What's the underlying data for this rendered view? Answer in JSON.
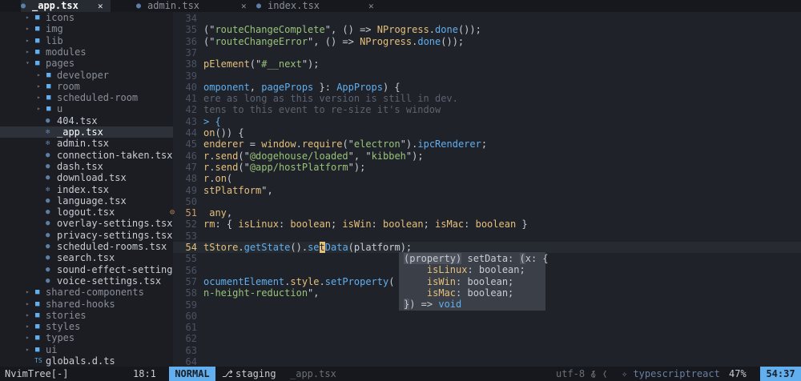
{
  "tabs": [
    {
      "label": "_app.tsx",
      "icon": "●",
      "close": "✕"
    },
    {
      "label": "admin.tsx",
      "icon": "●",
      "close": "✕"
    },
    {
      "label": "index.tsx",
      "icon": "●",
      "close": "✕"
    }
  ],
  "tree": {
    "items": [
      {
        "label": "icons",
        "type": "folder",
        "depth": 0,
        "arrow": "▸"
      },
      {
        "label": "img",
        "type": "folder",
        "depth": 0,
        "arrow": "▸"
      },
      {
        "label": "lib",
        "type": "folder",
        "depth": 0,
        "arrow": "▸"
      },
      {
        "label": "modules",
        "type": "folder",
        "depth": 0,
        "arrow": "▸"
      },
      {
        "label": "pages",
        "type": "folder",
        "depth": 0,
        "arrow": "▾"
      },
      {
        "label": "developer",
        "type": "folder",
        "depth": 1,
        "arrow": "▸"
      },
      {
        "label": "room",
        "type": "folder",
        "depth": 1,
        "arrow": "▸"
      },
      {
        "label": "scheduled-room",
        "type": "folder",
        "depth": 1,
        "arrow": "▸"
      },
      {
        "label": "u",
        "type": "folder",
        "depth": 1,
        "arrow": "▸"
      },
      {
        "label": "404.tsx",
        "type": "file",
        "depth": 1,
        "icon": "●"
      },
      {
        "label": "_app.tsx",
        "type": "file",
        "depth": 1,
        "icon": "✻",
        "selected": true
      },
      {
        "label": "admin.tsx",
        "type": "file",
        "depth": 1,
        "icon": "✻"
      },
      {
        "label": "connection-taken.tsx",
        "type": "file",
        "depth": 1,
        "icon": "●"
      },
      {
        "label": "dash.tsx",
        "type": "file",
        "depth": 1,
        "icon": "●"
      },
      {
        "label": "download.tsx",
        "type": "file",
        "depth": 1,
        "icon": "●"
      },
      {
        "label": "index.tsx",
        "type": "file",
        "depth": 1,
        "icon": "✻"
      },
      {
        "label": "language.tsx",
        "type": "file",
        "depth": 1,
        "icon": "●"
      },
      {
        "label": "logout.tsx",
        "type": "file",
        "depth": 1,
        "icon": "●"
      },
      {
        "label": "overlay-settings.tsx",
        "type": "file",
        "depth": 1,
        "icon": "●"
      },
      {
        "label": "privacy-settings.tsx",
        "type": "file",
        "depth": 1,
        "icon": "●"
      },
      {
        "label": "scheduled-rooms.tsx",
        "type": "file",
        "depth": 1,
        "icon": "●"
      },
      {
        "label": "search.tsx",
        "type": "file",
        "depth": 1,
        "icon": "●"
      },
      {
        "label": "sound-effect-setting",
        "type": "file",
        "depth": 1,
        "icon": "●"
      },
      {
        "label": "voice-settings.tsx",
        "type": "file",
        "depth": 1,
        "icon": "●"
      },
      {
        "label": "shared-components",
        "type": "folder",
        "depth": 0,
        "arrow": "▸"
      },
      {
        "label": "shared-hooks",
        "type": "folder",
        "depth": 0,
        "arrow": "▸"
      },
      {
        "label": "stories",
        "type": "folder",
        "depth": 0,
        "arrow": "▸"
      },
      {
        "label": "styles",
        "type": "folder",
        "depth": 0,
        "arrow": "▸"
      },
      {
        "label": "types",
        "type": "folder",
        "depth": 0,
        "arrow": "▸"
      },
      {
        "label": "ui",
        "type": "folder",
        "depth": 0,
        "arrow": "▸"
      },
      {
        "label": "globals.d.ts",
        "type": "file-ts",
        "depth": 0,
        "icon": "TS"
      }
    ]
  },
  "editor": {
    "lines": [
      {
        "num": "34",
        "tokens": []
      },
      {
        "num": "35",
        "tokens": [
          [
            "pl",
            "(\""
          ],
          [
            "str",
            "routeChangeComplete"
          ],
          [
            "pl",
            "\", () => "
          ],
          [
            "fn",
            "NProgress"
          ],
          [
            "pl",
            "."
          ],
          [
            "ty",
            "done"
          ],
          [
            "pl",
            "());"
          ]
        ]
      },
      {
        "num": "36",
        "tokens": [
          [
            "pl",
            "(\""
          ],
          [
            "str",
            "routeChangeError"
          ],
          [
            "pl",
            "\", () => "
          ],
          [
            "fn",
            "NProgress"
          ],
          [
            "pl",
            "."
          ],
          [
            "ty",
            "done"
          ],
          [
            "pl",
            "());"
          ]
        ]
      },
      {
        "num": "37",
        "tokens": []
      },
      {
        "num": "38",
        "tokens": [
          [
            "fn",
            "pElement"
          ],
          [
            "pl",
            "(\""
          ],
          [
            "str",
            "#__next"
          ],
          [
            "pl",
            "\");"
          ]
        ]
      },
      {
        "num": "39",
        "tokens": []
      },
      {
        "num": "40",
        "tokens": [
          [
            "ty",
            "omponent"
          ],
          [
            "pl",
            ", "
          ],
          [
            "ty",
            "pageProps"
          ],
          [
            "pl",
            " }: "
          ],
          [
            "ty",
            "AppProps"
          ],
          [
            "pl",
            ") {"
          ]
        ]
      },
      {
        "num": "41",
        "tokens": [
          [
            "cm",
            "ere as long as this version is still in dev."
          ]
        ]
      },
      {
        "num": "42",
        "tokens": [
          [
            "cm",
            "tens to this event to re-size it's window"
          ]
        ]
      },
      {
        "num": "43",
        "tokens": [
          [
            "ty",
            "> {"
          ]
        ]
      },
      {
        "num": "44",
        "tokens": [
          [
            "fn",
            "on"
          ],
          [
            "pl",
            "()) {"
          ]
        ]
      },
      {
        "num": "45",
        "tokens": [
          [
            "fn",
            "enderer"
          ],
          [
            "pl",
            " = "
          ],
          [
            "fn",
            "window"
          ],
          [
            "pl",
            "."
          ],
          [
            "fn",
            "require"
          ],
          [
            "pl",
            "(\""
          ],
          [
            "str",
            "electron"
          ],
          [
            "pl",
            "\")."
          ],
          [
            "ty",
            "ipcRenderer"
          ],
          [
            "pl",
            ";"
          ]
        ]
      },
      {
        "num": "46",
        "tokens": [
          [
            "fn",
            "r"
          ],
          [
            "pl",
            "."
          ],
          [
            "fn",
            "send"
          ],
          [
            "pl",
            "(\""
          ],
          [
            "str",
            "@dogehouse/loaded"
          ],
          [
            "pl",
            "\", \""
          ],
          [
            "str",
            "kibbeh"
          ],
          [
            "pl",
            "\");"
          ]
        ]
      },
      {
        "num": "47",
        "tokens": [
          [
            "fn",
            "r"
          ],
          [
            "pl",
            "."
          ],
          [
            "fn",
            "send"
          ],
          [
            "pl",
            "(\""
          ],
          [
            "str",
            "@app/hostPlatform"
          ],
          [
            "pl",
            "\");"
          ]
        ]
      },
      {
        "num": "48",
        "tokens": [
          [
            "fn",
            "r"
          ],
          [
            "pl",
            "."
          ],
          [
            "fn",
            "on"
          ],
          [
            "pl",
            "("
          ]
        ]
      },
      {
        "num": "49",
        "tokens": [
          [
            "fn",
            "stPlatform"
          ],
          [
            "pl",
            "\","
          ]
        ]
      },
      {
        "num": "50",
        "tokens": []
      },
      {
        "num": "51",
        "warn": true,
        "sign": "⊙",
        "tokens": [
          [
            "pl",
            " "
          ],
          [
            "fn",
            "any"
          ],
          [
            "pl",
            ","
          ]
        ]
      },
      {
        "num": "52",
        "tokens": [
          [
            "fn",
            "rm"
          ],
          [
            "pl",
            ": { "
          ],
          [
            "fn",
            "isLinux"
          ],
          [
            "pl",
            ": "
          ],
          [
            "fn",
            "boolean"
          ],
          [
            "pl",
            "; "
          ],
          [
            "fn",
            "isWin"
          ],
          [
            "pl",
            ": "
          ],
          [
            "fn",
            "boolean"
          ],
          [
            "pl",
            "; "
          ],
          [
            "fn",
            "isMac"
          ],
          [
            "pl",
            ": "
          ],
          [
            "fn",
            "boolean"
          ],
          [
            "pl",
            " }"
          ]
        ]
      },
      {
        "num": "53",
        "tokens": []
      },
      {
        "num": "54",
        "cursorline": true,
        "tokens": [
          [
            "fn",
            "tStore"
          ],
          [
            "pl",
            "."
          ],
          [
            "ty",
            "getState"
          ],
          [
            "pl",
            "()."
          ],
          [
            "ty",
            "se"
          ],
          [
            "cursor",
            "t"
          ],
          [
            "ty",
            "Data"
          ],
          [
            "pl",
            "("
          ],
          [
            "pl",
            "platform"
          ],
          [
            "pl",
            ");"
          ]
        ]
      },
      {
        "num": "55",
        "tokens": []
      },
      {
        "num": "56",
        "tokens": []
      },
      {
        "num": "57",
        "tokens": [
          [
            "ty",
            "ocumentElement"
          ],
          [
            "pl",
            "."
          ],
          [
            "fn",
            "style"
          ],
          [
            "pl",
            "."
          ],
          [
            "ty",
            "setProperty"
          ],
          [
            "pl",
            "("
          ]
        ]
      },
      {
        "num": "58",
        "tokens": [
          [
            "str",
            "n-height-reduction"
          ],
          [
            "pl",
            "\","
          ]
        ]
      },
      {
        "num": "59",
        "tokens": []
      },
      {
        "num": "60",
        "tokens": []
      },
      {
        "num": "61",
        "tokens": []
      },
      {
        "num": "62",
        "tokens": []
      },
      {
        "num": "63",
        "tokens": []
      },
      {
        "num": "64",
        "tokens": []
      }
    ]
  },
  "hover": {
    "lines": [
      [
        [
          "hl",
          "(property)"
        ],
        [
          "pl",
          " setData: "
        ],
        [
          "hl",
          "("
        ],
        [
          "pl",
          "x: {"
        ]
      ],
      [
        [
          "pl",
          "    "
        ],
        [
          "fn",
          "isLinux"
        ],
        [
          "pl",
          ": boolean;"
        ]
      ],
      [
        [
          "pl",
          "    "
        ],
        [
          "fn",
          "isWin"
        ],
        [
          "pl",
          ": boolean;"
        ]
      ],
      [
        [
          "pl",
          "    "
        ],
        [
          "fn",
          "isMac"
        ],
        [
          "pl",
          ": boolean;"
        ]
      ],
      [
        [
          "hl",
          "}"
        ],
        [
          "pl",
          ") => "
        ],
        [
          "ty",
          "void"
        ]
      ]
    ]
  },
  "status": {
    "tree": "NvimTree[-]",
    "position": "18:1",
    "mode": "NORMAL",
    "branch_icon": "⎇",
    "branch": "staging",
    "file": "_app.tsx",
    "encoding": "utf-8 ❬",
    "format": "♁ ❬",
    "filetype": "✧ typescriptreact",
    "percent": "47%",
    "cursor": "54:37"
  },
  "colors": {
    "mode_bg": "#61afef",
    "background": "#1f2229",
    "tree_bg": "#1b1d23"
  }
}
